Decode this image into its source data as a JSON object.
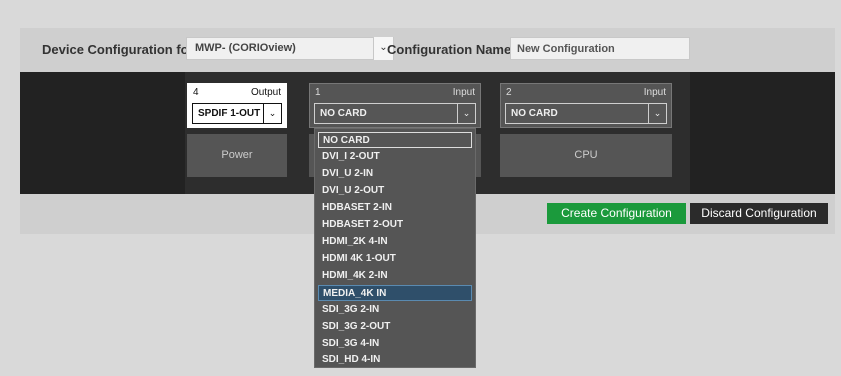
{
  "header": {
    "device_label": "Device Configuration for",
    "device_value": "MWP- (CORIOview)",
    "config_label": "Configuration Name:",
    "config_value": "New Configuration"
  },
  "slots": [
    {
      "number": "4",
      "type": "Output",
      "selected": "SPDIF 1-OUT"
    },
    {
      "number": "1",
      "type": "Input",
      "selected": "NO CARD"
    },
    {
      "number": "2",
      "type": "Input",
      "selected": "NO CARD"
    }
  ],
  "modules": {
    "power": "Power",
    "cpu": "CPU"
  },
  "buttons": {
    "create": "Create Configuration",
    "discard": "Discard Configuration"
  },
  "dropdown": {
    "options": [
      "NO CARD",
      "DVI_I 2-OUT",
      "DVI_U 2-IN",
      "DVI_U 2-OUT",
      "HDBASET 2-IN",
      "HDBASET 2-OUT",
      "HDMI_2K 4-IN",
      "HDMI 4K 1-OUT",
      "HDMI_4K 2-IN",
      "MEDIA_4K IN",
      "SDI_3G 2-IN",
      "SDI_3G 2-OUT",
      "SDI_3G 4-IN",
      "SDI_HD 4-IN"
    ],
    "selected": "NO CARD",
    "highlighted": "MEDIA_4K IN"
  },
  "icons": {
    "select_chevron": "chevron-down-icon"
  },
  "colors": {
    "create_button": "#1b9a3c",
    "discard_button": "#2b2b2b",
    "highlight": "#2f4f6a"
  }
}
